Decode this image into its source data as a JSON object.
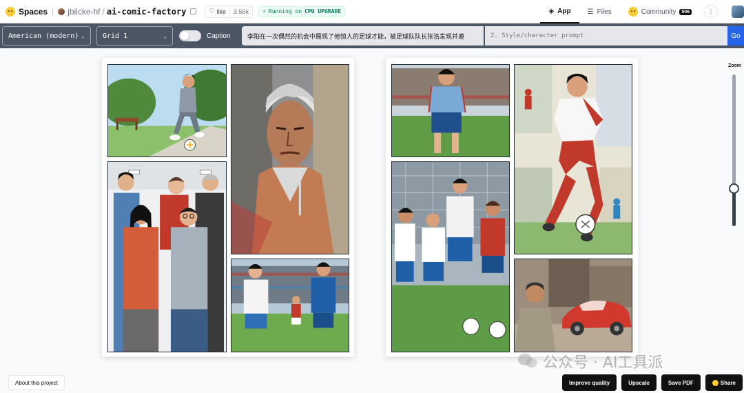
{
  "header": {
    "spaces_label": "Spaces",
    "owner": "jbilcke-hf",
    "repo": "ai-comic-factory",
    "like_label": "like",
    "like_count": "3.56k",
    "status_prefix": "Running on",
    "status_hardware": "CPU UPGRADE"
  },
  "nav": {
    "app_label": "App",
    "files_label": "Files",
    "community_label": "Community",
    "community_count": "506"
  },
  "controls": {
    "style_value": "American (modern)",
    "layout_value": "Grid 1",
    "caption_label": "Caption",
    "caption_enabled": false,
    "story_prompt": "李阳在一次偶然的机会中展现了他惊人的足球才能，被足球队队长张浩发现并邀",
    "style_prompt_placeholder": "2. Style/character prompt",
    "go_label": "Go"
  },
  "zoom": {
    "label": "Zoom",
    "level": 0.25
  },
  "footer": {
    "about_label": "About this project",
    "improve_label": "Improve quality",
    "upscale_label": "Upscale",
    "save_pdf_label": "Save PDF",
    "share_label": "Share"
  },
  "watermark": {
    "text": "公众号 · AI工具派"
  }
}
